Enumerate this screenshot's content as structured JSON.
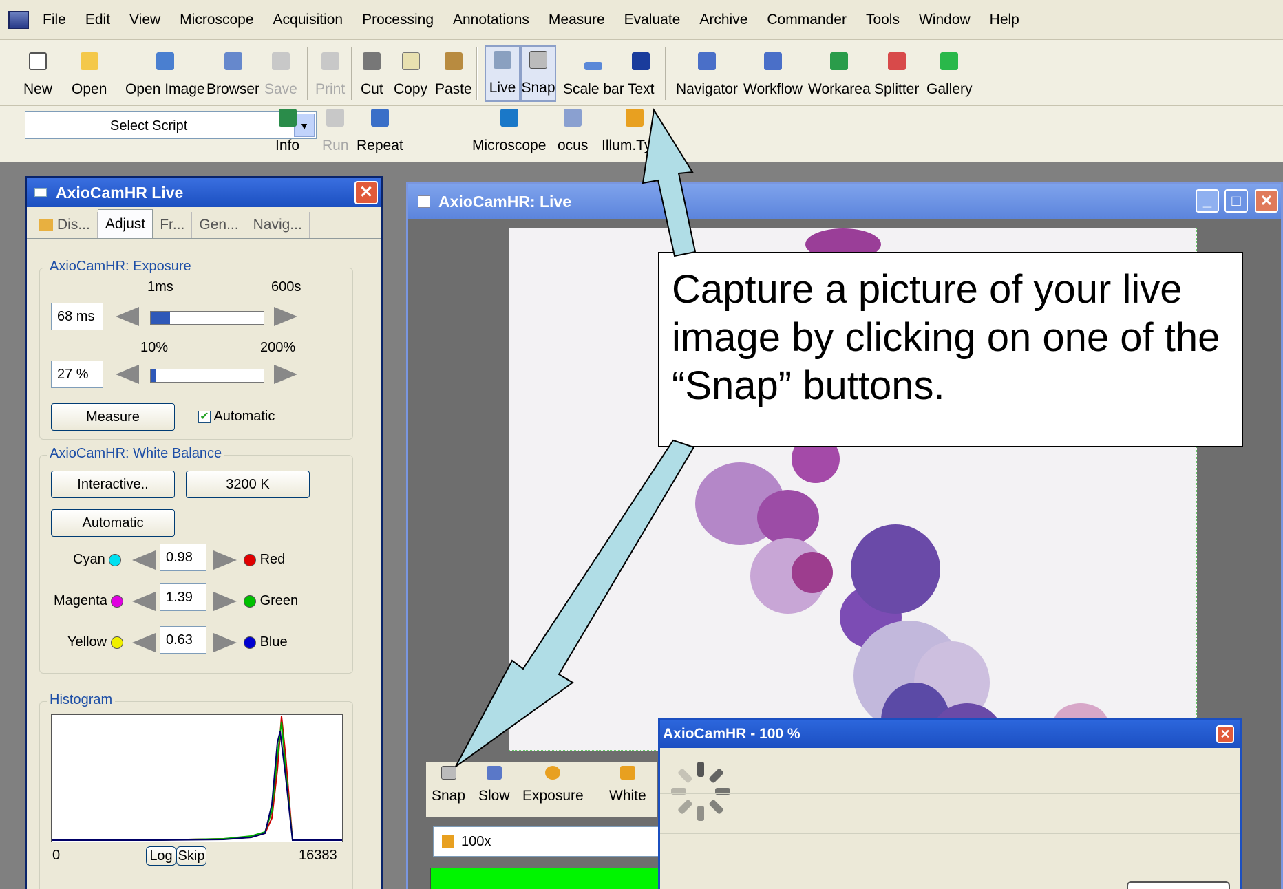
{
  "menubar": {
    "items": [
      "File",
      "Edit",
      "View",
      "Microscope",
      "Acquisition",
      "Processing",
      "Annotations",
      "Measure",
      "Evaluate",
      "Archive",
      "Commander",
      "Tools",
      "Window",
      "Help"
    ]
  },
  "toolbar1": {
    "buttons": [
      {
        "label": "New",
        "icon": "new-document-icon"
      },
      {
        "label": "Open",
        "icon": "open-folder-icon"
      },
      {
        "label": "Open Image",
        "icon": "open-image-icon"
      },
      {
        "label": "Browser",
        "icon": "browser-icon"
      },
      {
        "label": "Save",
        "icon": "save-icon",
        "disabled": true
      },
      {
        "label": "Print",
        "icon": "print-icon",
        "disabled": true
      },
      {
        "label": "Cut",
        "icon": "cut-icon"
      },
      {
        "label": "Copy",
        "icon": "copy-icon"
      },
      {
        "label": "Paste",
        "icon": "paste-icon"
      },
      {
        "label": "Live",
        "icon": "live-icon",
        "pressed": true
      },
      {
        "label": "Snap",
        "icon": "camera-icon",
        "pressed": true
      },
      {
        "label": "Scale bar",
        "icon": "scale-bar-icon"
      },
      {
        "label": "Text",
        "icon": "text-icon"
      },
      {
        "label": "Navigator",
        "icon": "navigator-icon"
      },
      {
        "label": "Workflow",
        "icon": "workflow-icon"
      },
      {
        "label": "Workarea",
        "icon": "workarea-icon"
      },
      {
        "label": "Splitter",
        "icon": "splitter-icon"
      },
      {
        "label": "Gallery",
        "icon": "gallery-icon"
      }
    ]
  },
  "toolbar2": {
    "script_label": "Select Script",
    "script_value": "",
    "info": "Info",
    "run": "Run",
    "repeat": "Repeat",
    "microscope": "Microscope",
    "focus": "ocus",
    "illum": "Illum.Type"
  },
  "live_panel": {
    "title": "AxioCamHR Live",
    "tabs": [
      "Dis...",
      "Adjust",
      "Fr...",
      "Gen...",
      "Navig..."
    ],
    "exposure": {
      "group": "AxioCamHR: Exposure",
      "min": "1ms",
      "max": "600s",
      "value": "68 ms",
      "fraction": 0.17,
      "gain_min": "10%",
      "gain_max": "200%",
      "gain_value": "27 %",
      "gain_fraction": 0.05,
      "measure": "Measure",
      "automatic": "Automatic"
    },
    "white_balance": {
      "group": "AxioCamHR: White Balance",
      "interactive": "Interactive..",
      "temperature": "3200 K",
      "automatic": "Automatic",
      "rows": [
        {
          "left": "Cyan",
          "value": "0.98",
          "right": "Red"
        },
        {
          "left": "Magenta",
          "value": "1.39",
          "right": "Green"
        },
        {
          "left": "Yellow",
          "value": "0.63",
          "right": "Blue"
        }
      ]
    },
    "histogram": {
      "group": "Histogram",
      "min": "0",
      "max": "16383",
      "log": "Log",
      "skip": "Skip"
    }
  },
  "image_window": {
    "title": "AxioCamHR: Live",
    "bottom_buttons": [
      "Snap",
      "Slow",
      "Exposure",
      "White"
    ],
    "objective": "100x"
  },
  "progress_dialog": {
    "title": "AxioCamHR - 100 %"
  },
  "callout": {
    "text": "Capture a picture of your live image by clicking on one of the “Snap” buttons."
  },
  "colors": {
    "arrow": "#add8e6",
    "title_active": "#1b4fc0",
    "title_inactive": "#7fa3ec"
  }
}
